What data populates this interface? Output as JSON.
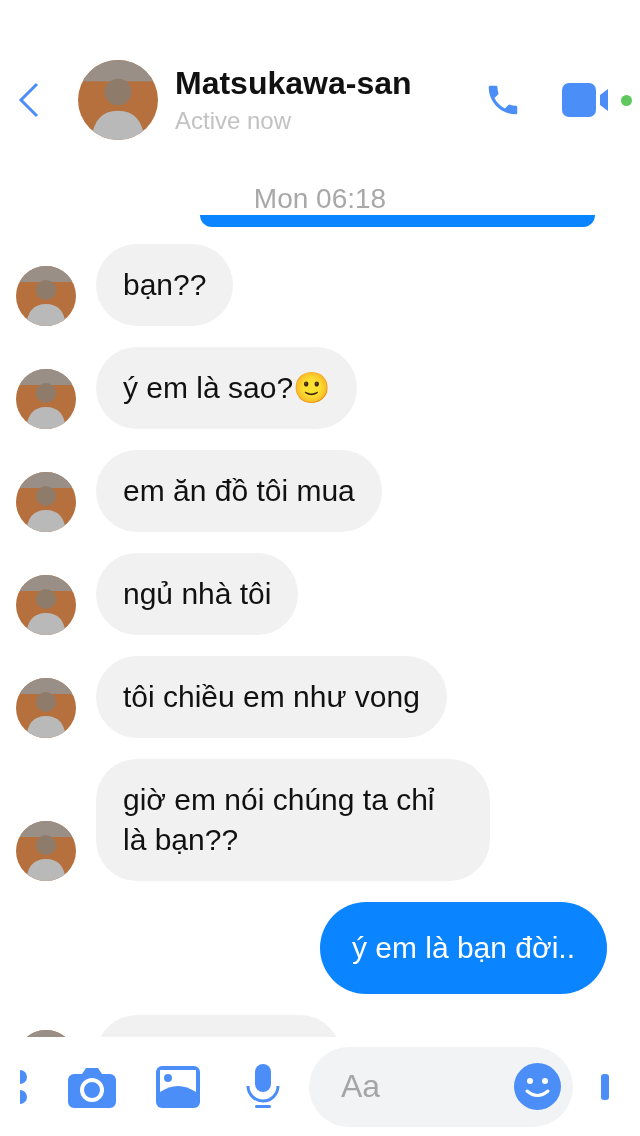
{
  "header": {
    "name": "Matsukawa-san",
    "status": "Active now",
    "online": true
  },
  "timestamp": "Mon 06:18",
  "messages": [
    {
      "kind": "cut",
      "outgoing": true
    },
    {
      "kind": "text",
      "outgoing": false,
      "text": "bạn??"
    },
    {
      "kind": "text",
      "outgoing": false,
      "text": "ý em là sao?🙂"
    },
    {
      "kind": "text",
      "outgoing": false,
      "text": "em ăn đồ tôi mua"
    },
    {
      "kind": "text",
      "outgoing": false,
      "text": "ngủ nhà tôi"
    },
    {
      "kind": "text",
      "outgoing": false,
      "text": "tôi chiều em như vong"
    },
    {
      "kind": "text",
      "outgoing": false,
      "text": "giờ em nói chúng ta chỉ là bạn??"
    },
    {
      "kind": "text",
      "outgoing": true,
      "text": "ý em là bạn đời.."
    },
    {
      "kind": "cut",
      "outgoing": false
    }
  ],
  "composer": {
    "placeholder": "Aa"
  }
}
